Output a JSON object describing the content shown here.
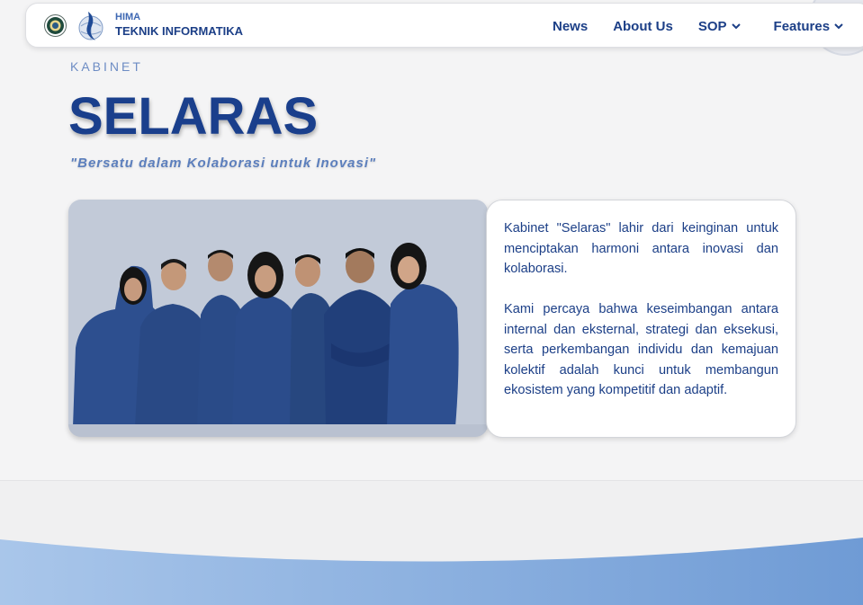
{
  "navbar": {
    "brand_top": "HIMA",
    "brand_bottom": "TEKNIK INFORMATIKA",
    "links": [
      {
        "label": "News",
        "has_dropdown": false
      },
      {
        "label": "About Us",
        "has_dropdown": false
      },
      {
        "label": "SOP",
        "has_dropdown": true
      },
      {
        "label": "Features",
        "has_dropdown": true
      }
    ]
  },
  "hero": {
    "kicker": "KABINET",
    "title": "SELARAS",
    "tagline": "\"Bersatu dalam Kolaborasi untuk Inovasi\""
  },
  "about": {
    "paragraph1": "Kabinet \"Selaras\" lahir dari keinginan untuk menciptakan harmoni antara inovasi dan kolaborasi.",
    "paragraph2": "Kami percaya bahwa keseimbangan antara internal dan eksternal, strategi dan eksekusi, serta perkembangan individu dan kemajuan kolektif adalah kunci untuk membangun ekosistem yang kompetitif dan adaptif."
  },
  "colors": {
    "primary": "#1a3f8c",
    "accent_light": "#6d8cc4",
    "wave_left": "#a9c6ea",
    "wave_right": "#6f9bd5"
  },
  "icons": [
    "university-seal-icon",
    "hima-logo-icon",
    "chevron-down-icon"
  ]
}
